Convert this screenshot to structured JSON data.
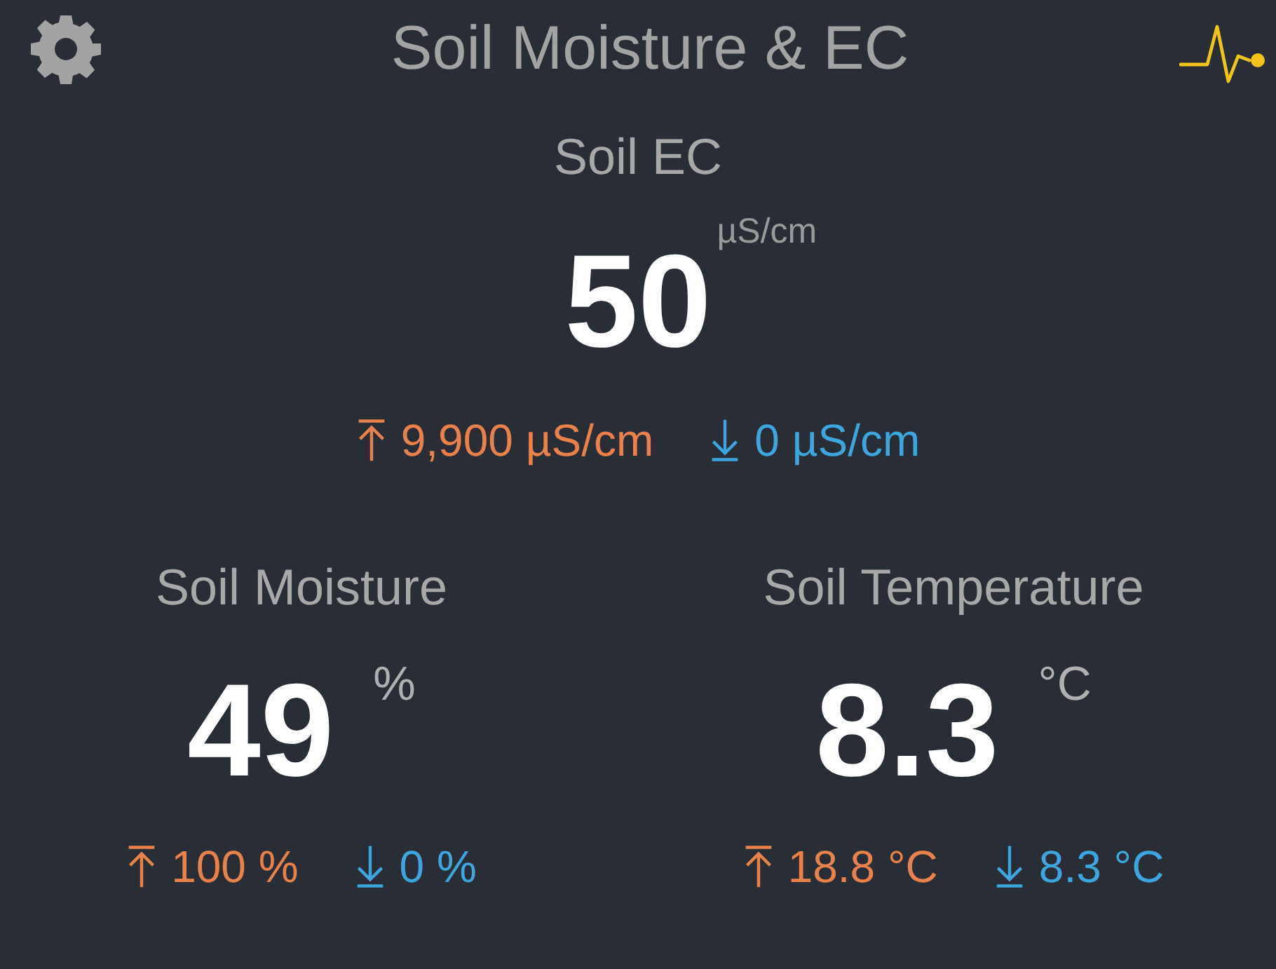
{
  "header": {
    "title": "Soil Moisture & EC"
  },
  "primary": {
    "label": "Soil EC",
    "value": "50",
    "unit": "µS/cm",
    "max": "9,900 µS/cm",
    "min": "0 µS/cm"
  },
  "secondary": [
    {
      "label": "Soil Moisture",
      "value": "49",
      "unit": "%",
      "max": "100 %",
      "min": "0 %"
    },
    {
      "label": "Soil Temperature",
      "value": "8.3",
      "unit": "°C",
      "max": "18.8 °C",
      "min": "8.3 °C"
    }
  ]
}
